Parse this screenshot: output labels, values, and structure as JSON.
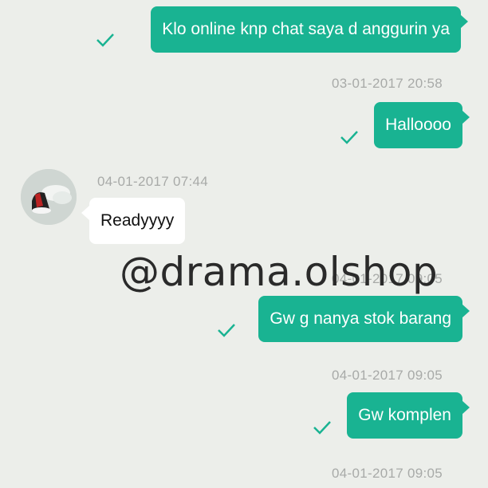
{
  "messages": [
    {
      "text": "Klo online knp chat saya d anggurin ya",
      "status": "sent"
    },
    {
      "timestamp": "03-01-2017 20:58",
      "text": "Halloooo",
      "status": "sent"
    },
    {
      "timestamp": "04-01-2017 07:44",
      "text": "Readyyyy",
      "from": "seller"
    },
    {
      "timestamp": "04-01-2017 09:05",
      "text": "Gw g nanya stok barang",
      "status": "sent"
    },
    {
      "timestamp": "04-01-2017 09:05",
      "text": "Gw komplen",
      "status": "sent"
    },
    {
      "timestamp": "04-01-2017 09:05"
    }
  ],
  "watermark": "@drama.olshop",
  "colors": {
    "outgoing_bubble": "#19b392",
    "incoming_bubble": "#ffffff",
    "background": "#eceeea",
    "timestamp": "#a8aaa8",
    "check": "#19b392"
  },
  "icons": {
    "sent_check": "check-icon",
    "avatar": "avatar-image"
  }
}
